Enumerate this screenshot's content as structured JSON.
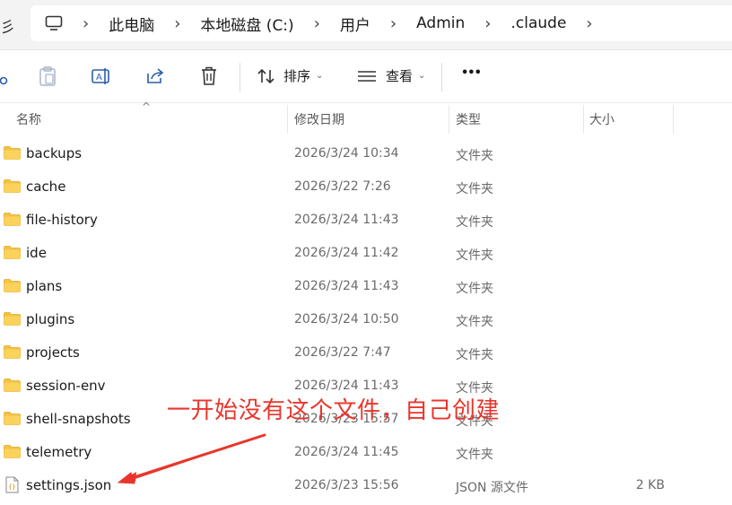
{
  "window": {
    "left_stub_text": "彡"
  },
  "breadcrumb": {
    "items": [
      "此电脑",
      "本地磁盘 (C:)",
      "用户",
      "Admin",
      ".claude"
    ]
  },
  "toolbar": {
    "sort_label": "排序",
    "view_label": "查看",
    "more_label": "•••"
  },
  "columns": {
    "name": "名称",
    "modified": "修改日期",
    "type": "类型",
    "size": "大小"
  },
  "files": [
    {
      "name": "backups",
      "modified": "2026/3/24 10:34",
      "type": "文件夹",
      "size": "",
      "kind": "folder"
    },
    {
      "name": "cache",
      "modified": "2026/3/22 7:26",
      "type": "文件夹",
      "size": "",
      "kind": "folder"
    },
    {
      "name": "file-history",
      "modified": "2026/3/24 11:43",
      "type": "文件夹",
      "size": "",
      "kind": "folder"
    },
    {
      "name": "ide",
      "modified": "2026/3/24 11:42",
      "type": "文件夹",
      "size": "",
      "kind": "folder"
    },
    {
      "name": "plans",
      "modified": "2026/3/24 11:43",
      "type": "文件夹",
      "size": "",
      "kind": "folder"
    },
    {
      "name": "plugins",
      "modified": "2026/3/24 10:50",
      "type": "文件夹",
      "size": "",
      "kind": "folder"
    },
    {
      "name": "projects",
      "modified": "2026/3/22 7:47",
      "type": "文件夹",
      "size": "",
      "kind": "folder"
    },
    {
      "name": "session-env",
      "modified": "2026/3/24 11:43",
      "type": "文件夹",
      "size": "",
      "kind": "folder"
    },
    {
      "name": "shell-snapshots",
      "modified": "2026/3/23 15:57",
      "type": "文件夹",
      "size": "",
      "kind": "folder"
    },
    {
      "name": "telemetry",
      "modified": "2026/3/24 11:45",
      "type": "文件夹",
      "size": "",
      "kind": "folder"
    },
    {
      "name": "settings.json",
      "modified": "2026/3/23 15:56",
      "type": "JSON 源文件",
      "size": "2 KB",
      "kind": "json"
    }
  ],
  "annotation": {
    "text": "一开始没有这个文件，自己创建",
    "color": "#e8362c"
  },
  "colors": {
    "folder": "#f5c342",
    "folder_dark": "#e0a82a",
    "toolbar_icon": "#2a5fa8"
  }
}
